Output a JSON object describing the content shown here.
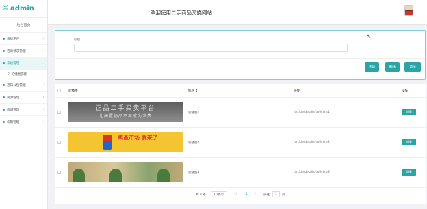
{
  "sidebar": {
    "brand": "admin",
    "home": "后台首页",
    "items": [
      {
        "label": "系统用户"
      },
      {
        "label": "咨询请求管理"
      },
      {
        "label": "系统管理"
      },
      {
        "label": "通知公告管理"
      },
      {
        "label": "资源管理"
      },
      {
        "label": "商城管理"
      },
      {
        "label": "权限管理"
      }
    ],
    "submenu": "轮播图管理"
  },
  "header": {
    "title": "欢迎使用二手商品交换网站"
  },
  "search": {
    "label": "标题",
    "placeholder": ""
  },
  "buttons": {
    "query": "查询",
    "delete": "删除",
    "add": "添加"
  },
  "table": {
    "columns": [
      "轮播图",
      "标题 ↕",
      "链接",
      "操作"
    ],
    "rows": [
      {
        "title": "轮播图1",
        "link": "/article/details?article=1",
        "action": "详情",
        "img_text1": "正品二手买卖平台",
        "img_text2": "让闲置物品不再成为浪费"
      },
      {
        "title": "轮播图2",
        "link": "/article/details?article=2",
        "action": "详情",
        "img_text1": "跳蚤市场 我来了"
      },
      {
        "title": "轮播图3",
        "link": "/article/details?article=3",
        "action": "详情"
      }
    ]
  },
  "pager": {
    "total": "共 3 条",
    "page_size": "10条/页",
    "prev": "‹",
    "current": "1",
    "next": "›",
    "goto": "前往",
    "goto_page": "1",
    "page_unit": "页"
  },
  "colors": {
    "accent": "#2aa4a4"
  }
}
